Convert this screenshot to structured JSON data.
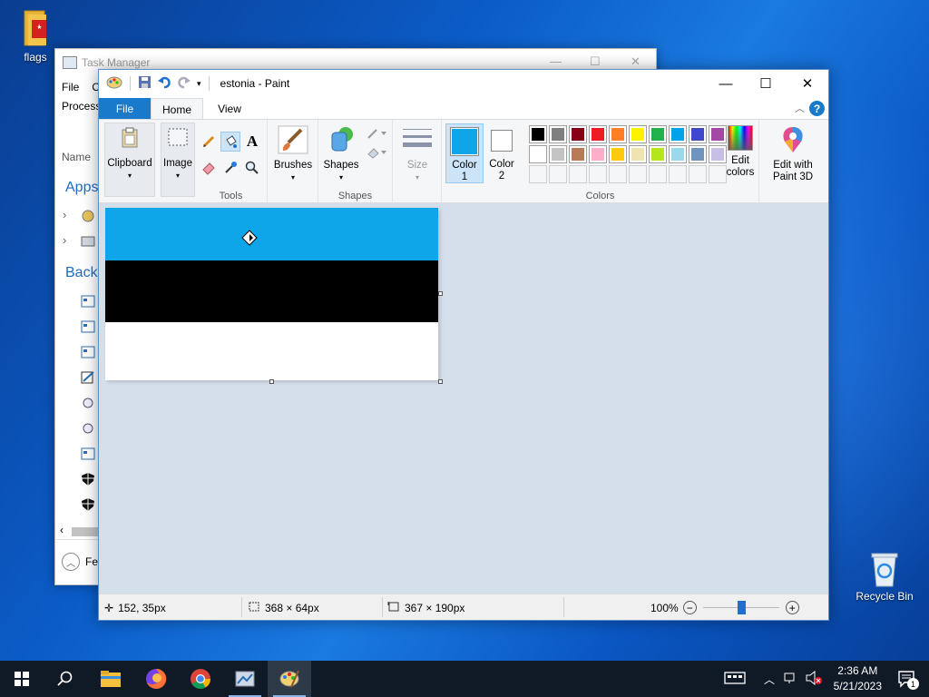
{
  "desktop": {
    "icons": [
      {
        "label": "flags"
      },
      {
        "label": "Recycle Bin"
      }
    ]
  },
  "task_manager": {
    "title": "Task Manager",
    "menu": [
      "File",
      "O"
    ],
    "tab": "Process",
    "column": "Name",
    "groups": [
      "Apps",
      "Backg"
    ],
    "footer": "Fev"
  },
  "paint": {
    "title": "estonia - Paint",
    "tabs": [
      "File",
      "Home",
      "View"
    ],
    "help": "?",
    "groups": {
      "clipboard": "Clipboard",
      "image": "Image",
      "tools": "Tools",
      "brushes": "Brushes",
      "shapes_btn": "Shapes",
      "shapes_group": "Shapes",
      "size": "Size",
      "color1": "Color",
      "color1_num": "1",
      "color2": "Color",
      "color2_num": "2",
      "colors_group": "Colors",
      "edit_colors": "Edit",
      "edit_colors2": "colors",
      "paint3d": "Edit with",
      "paint3d2": "Paint 3D"
    },
    "color1_value": "#0ea5e9",
    "color2_value": "#ffffff",
    "palette_row1": [
      "#000000",
      "#7f7f7f",
      "#880015",
      "#ed1c24",
      "#ff7f27",
      "#fff200",
      "#22b14c",
      "#00a2e8",
      "#3f48cc",
      "#a349a4"
    ],
    "palette_row2": [
      "#ffffff",
      "#c3c3c3",
      "#b97a57",
      "#ffaec9",
      "#ffc90e",
      "#efe4b0",
      "#b5e61d",
      "#99d9ea",
      "#7092be",
      "#c8bfe7"
    ],
    "flag_colors": [
      "#0ea5e9",
      "#000000",
      "#ffffff"
    ],
    "status": {
      "cursor": "152, 35px",
      "selection": "368 × 64px",
      "image_size": "367 × 190px",
      "zoom": "100%"
    }
  },
  "taskbar": {
    "time": "2:36 AM",
    "date": "5/21/2023",
    "notif_count": "1"
  }
}
